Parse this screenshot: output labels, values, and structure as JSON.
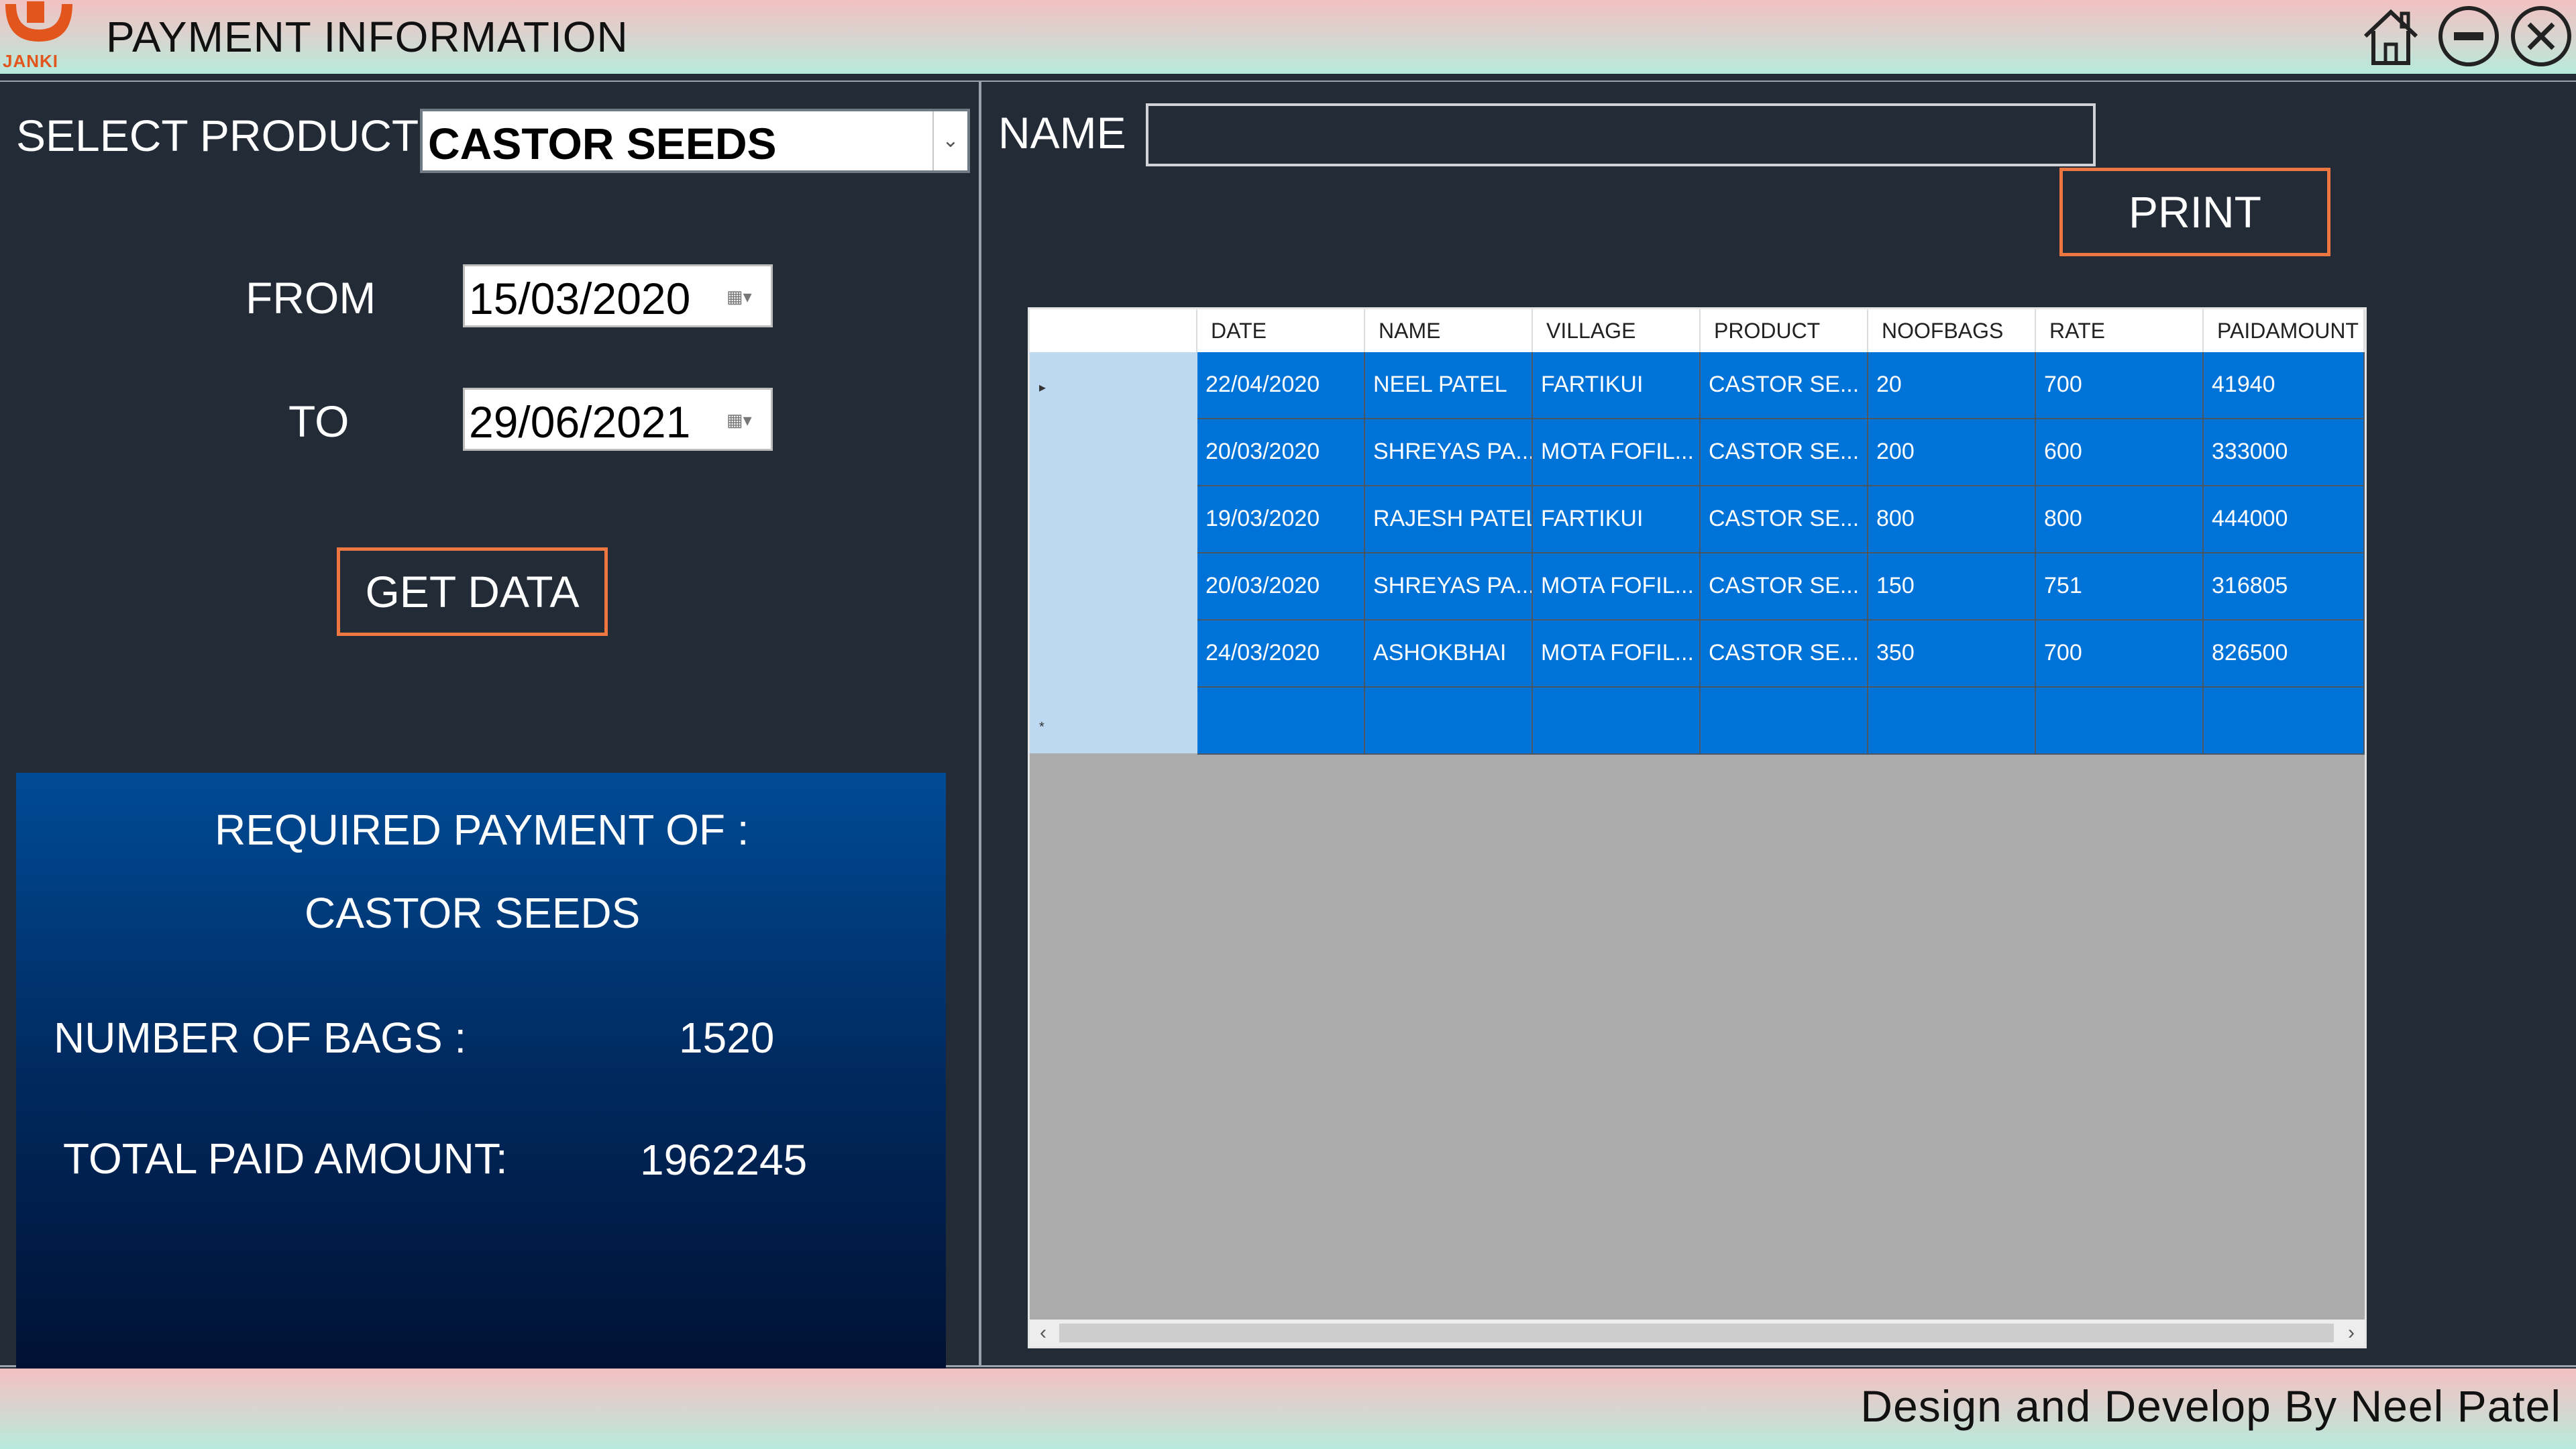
{
  "window": {
    "title": "PAYMENT INFORMATION",
    "logo_text": "JANKI",
    "icons": [
      "home-icon",
      "minimize-icon",
      "close-icon"
    ]
  },
  "filters": {
    "select_product_label": "SELECT PRODUCT",
    "selected_product": "CASTOR SEEDS",
    "from_label": "FROM",
    "from_date": "15/03/2020",
    "to_label": "TO",
    "to_date": "29/06/2021",
    "get_data_label": "GET DATA"
  },
  "summary": {
    "heading": "REQUIRED PAYMENT OF :",
    "product": "CASTOR SEEDS",
    "bags_label": "NUMBER OF BAGS :",
    "bags_value": "1520",
    "paid_label": "TOTAL PAID AMOUNT:",
    "paid_value": "1962245"
  },
  "name_filter": {
    "label": "NAME",
    "value": ""
  },
  "print_label": "PRINT",
  "grid": {
    "columns": [
      "DATE",
      "NAME",
      "VILLAGE",
      "PRODUCT",
      "NOOFBAGS",
      "RATE",
      "PAIDAMOUNT"
    ],
    "rows": [
      [
        "22/04/2020",
        "NEEL PATEL",
        "FARTIKUI",
        "CASTOR SE...",
        "20",
        "700",
        "41940"
      ],
      [
        "20/03/2020",
        "SHREYAS PA...",
        "MOTA FOFIL...",
        "CASTOR SE...",
        "200",
        "600",
        "333000"
      ],
      [
        "19/03/2020",
        "RAJESH PATEL",
        "FARTIKUI",
        "CASTOR SE...",
        "800",
        "800",
        "444000"
      ],
      [
        "20/03/2020",
        "SHREYAS PA...",
        "MOTA FOFIL...",
        "CASTOR SE...",
        "150",
        "751",
        "316805"
      ],
      [
        "24/03/2020",
        "ASHOKBHAI",
        "MOTA FOFIL...",
        "CASTOR SE...",
        "350",
        "700",
        "826500"
      ]
    ]
  },
  "footer": {
    "credit": "Design and Develop By Neel Patel"
  },
  "colors": {
    "accent_border": "#ee7641",
    "grid_row": "#0073d8",
    "panel_bg": "#222b36"
  }
}
